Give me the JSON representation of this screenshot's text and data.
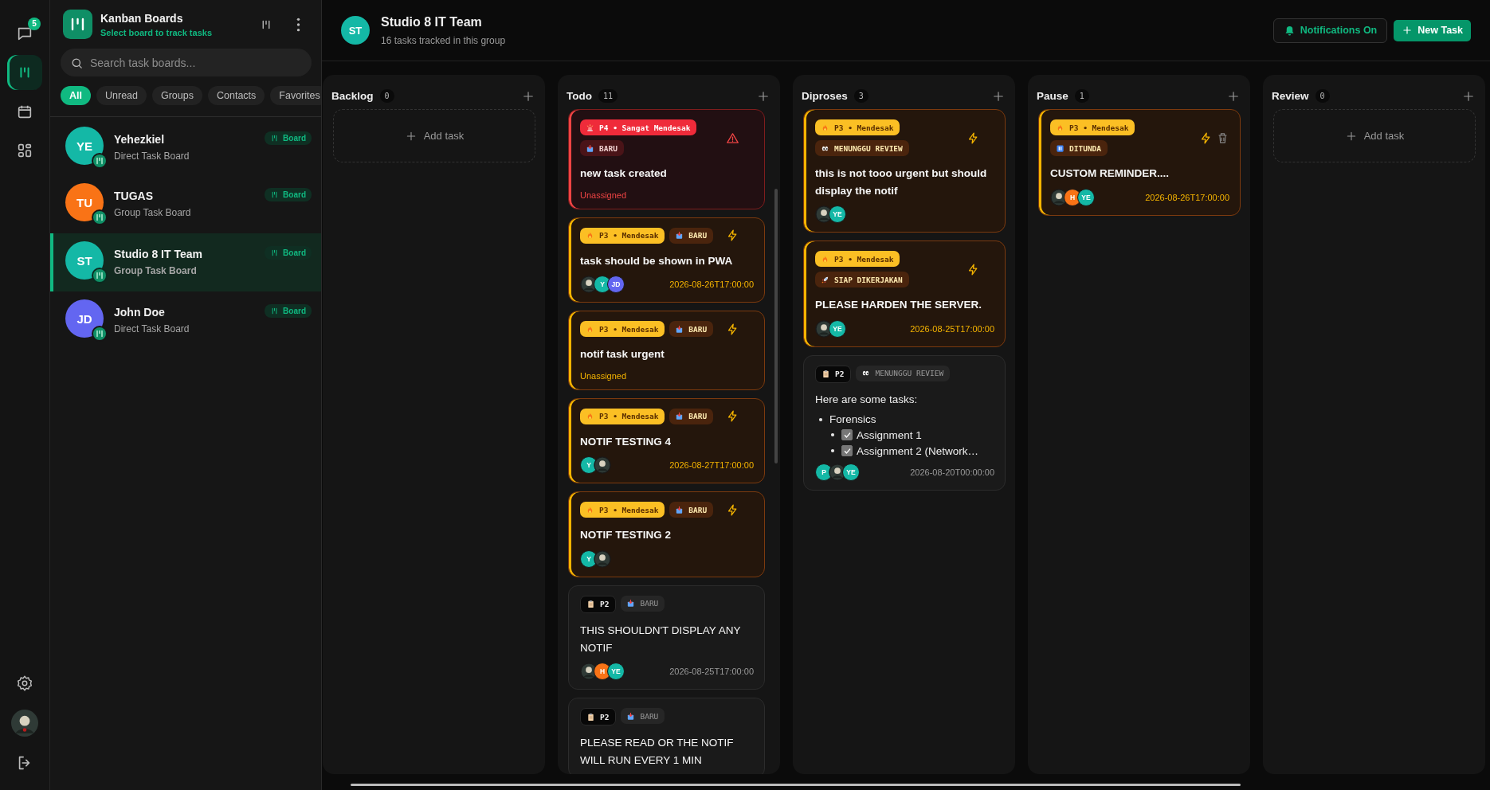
{
  "rail": {
    "chat_badge": "5",
    "items": [
      {
        "kind": "chat",
        "selected": false
      },
      {
        "kind": "board",
        "selected": true
      },
      {
        "kind": "calendar",
        "selected": false
      },
      {
        "kind": "grid",
        "selected": false
      }
    ],
    "bottom": [
      {
        "kind": "settings"
      },
      {
        "kind": "profile"
      },
      {
        "kind": "logout"
      }
    ]
  },
  "sidebar": {
    "title": "Kanban Boards",
    "subtitle": "Select board to track tasks",
    "search": {
      "placeholder": "Search task boards..."
    },
    "filters": [
      {
        "label": "All",
        "selected": true
      },
      {
        "label": "Unread",
        "selected": false
      },
      {
        "label": "Groups",
        "selected": false
      },
      {
        "label": "Contacts",
        "selected": false
      },
      {
        "label": "Favorites",
        "selected": false
      }
    ],
    "boards": [
      {
        "initials": "YE",
        "name": "Yehezkiel",
        "type": "Direct Task Board",
        "badge": "Board",
        "color": "#14b8a6",
        "selected": false
      },
      {
        "initials": "TU",
        "name": "TUGAS",
        "type": "Group Task Board",
        "badge": "Board",
        "color": "#f97316",
        "selected": false
      },
      {
        "initials": "ST",
        "name": "Studio 8 IT Team",
        "type": "Group Task Board",
        "badge": "Board",
        "color": "#14b8a6",
        "selected": true
      },
      {
        "initials": "JD",
        "name": "John Doe",
        "type": "Direct Task Board",
        "badge": "Board",
        "color": "#6366f1",
        "selected": false
      }
    ]
  },
  "header": {
    "initials": "ST",
    "title": "Studio 8 IT Team",
    "subtitle": "16 tasks tracked in this group",
    "notifications": "Notifications On",
    "new_task": "New Task"
  },
  "columns": [
    {
      "title": "Backlog",
      "count": "0",
      "scrollable": false,
      "add_label": "Add task"
    },
    {
      "title": "Todo",
      "count": "11",
      "scrollable": true,
      "tasks": [
        {
          "priority": {
            "kind": "p4",
            "label": "P4 • Sangat Mendesak"
          },
          "status": {
            "kind": "new",
            "label": "BARU"
          },
          "title": "new task created",
          "unassigned": "Unassigned"
        },
        {
          "priority": {
            "kind": "p3",
            "label": "P3 • Mendesak"
          },
          "status": {
            "kind": "new",
            "label": "BARU"
          },
          "title": "task should be shown in PWA",
          "assignees": [
            {
              "kind": "photo"
            },
            {
              "kind": "initials",
              "initials": "Y",
              "color": "#14b8a6"
            },
            {
              "kind": "initials",
              "initials": "JD",
              "color": "#6366f1"
            }
          ],
          "due": "2026-08-26T17:00:00"
        },
        {
          "priority": {
            "kind": "p3",
            "label": "P3 • Mendesak"
          },
          "status": {
            "kind": "new",
            "label": "BARU"
          },
          "title": "notif task urgent",
          "unassigned": "Unassigned"
        },
        {
          "priority": {
            "kind": "p3",
            "label": "P3 • Mendesak"
          },
          "status": {
            "kind": "new",
            "label": "BARU"
          },
          "title": "NOTIF TESTING 4",
          "assignees": [
            {
              "kind": "initials",
              "initials": "Y",
              "color": "#14b8a6"
            },
            {
              "kind": "photo"
            }
          ],
          "due": "2026-08-27T17:00:00"
        },
        {
          "priority": {
            "kind": "p3",
            "label": "P3 • Mendesak"
          },
          "status": {
            "kind": "new",
            "label": "BARU"
          },
          "title": "NOTIF TESTING 2",
          "assignees": [
            {
              "kind": "initials",
              "initials": "Y",
              "color": "#14b8a6"
            },
            {
              "kind": "photo"
            }
          ]
        },
        {
          "priority": {
            "kind": "p2",
            "label": "P2"
          },
          "status": {
            "kind": "new",
            "label": "BARU"
          },
          "title": "THIS SHOULDN'T DISPLAY ANY NOTIF",
          "assignees": [
            {
              "kind": "photo"
            },
            {
              "kind": "initials",
              "initials": "H",
              "color": "#f97316"
            },
            {
              "kind": "initials",
              "initials": "YE",
              "color": "#14b8a6"
            }
          ],
          "due": "2026-08-25T17:00:00"
        },
        {
          "priority": {
            "kind": "p2",
            "label": "P2"
          },
          "status": {
            "kind": "new",
            "label": "BARU"
          },
          "title": "PLEASE READ OR THE NOTIF WILL RUN EVERY 1 MIN"
        }
      ]
    },
    {
      "title": "Diproses",
      "count": "3",
      "scrollable": false,
      "tasks": [
        {
          "priority": {
            "kind": "p3",
            "label": "P3 • Mendesak"
          },
          "status": {
            "kind": "review",
            "label": "MENUNGGU REVIEW"
          },
          "title": "this is not tooo urgent but should display the notif",
          "assignees": [
            {
              "kind": "photo"
            },
            {
              "kind": "initials",
              "initials": "YE",
              "color": "#14b8a6"
            }
          ]
        },
        {
          "priority": {
            "kind": "p3",
            "label": "P3 • Mendesak"
          },
          "status": {
            "kind": "ready",
            "label": "SIAP DIKERJAKAN"
          },
          "title": "PLEASE HARDEN THE SERVER.",
          "assignees": [
            {
              "kind": "photo"
            },
            {
              "kind": "initials",
              "initials": "YE",
              "color": "#14b8a6"
            }
          ],
          "due": "2026-08-25T17:00:00"
        },
        {
          "priority": {
            "kind": "p2",
            "label": "P2"
          },
          "status": {
            "kind": "review",
            "label": "MENUNGGU REVIEW"
          },
          "body": {
            "intro": "Here are some tasks:",
            "items": [
              {
                "text": "Forensics",
                "children": [
                  {
                    "text": "Assignment 1",
                    "checked": true
                  },
                  {
                    "text": "Assignment 2 (Network…",
                    "checked": true
                  }
                ]
              }
            ]
          },
          "assignees": [
            {
              "kind": "initials",
              "initials": "P",
              "color": "#14b8a6"
            },
            {
              "kind": "photo"
            },
            {
              "kind": "initials",
              "initials": "YE",
              "color": "#14b8a6"
            }
          ],
          "due": "2026-08-20T00:00:00"
        }
      ]
    },
    {
      "title": "Pause",
      "count": "1",
      "scrollable": false,
      "tasks": [
        {
          "priority": {
            "kind": "p3",
            "label": "P3 • Mendesak"
          },
          "status": {
            "kind": "paused",
            "label": "DITUNDA"
          },
          "deletable": true,
          "title": "CUSTOM REMINDER....",
          "assignees": [
            {
              "kind": "photo"
            },
            {
              "kind": "initials",
              "initials": "H",
              "color": "#f97316"
            },
            {
              "kind": "initials",
              "initials": "YE",
              "color": "#14b8a6"
            }
          ],
          "due": "2026-08-26T17:00:00"
        }
      ]
    },
    {
      "title": "Review",
      "count": "0",
      "scrollable": false,
      "add_label": "Add task"
    }
  ]
}
